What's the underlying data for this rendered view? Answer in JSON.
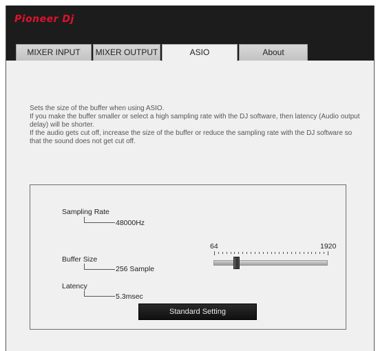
{
  "header": {
    "logo_text": "Pioneer Dj"
  },
  "tabs": [
    {
      "label": "MIXER INPUT",
      "active": false
    },
    {
      "label": "MIXER OUTPUT",
      "active": false
    },
    {
      "label": "ASIO",
      "active": true
    },
    {
      "label": "About",
      "active": false
    }
  ],
  "description": [
    "Sets the size of the buffer when using ASIO.",
    "If you make the buffer smaller or select a high sampling rate with the DJ software, then latency (Audio output delay) will be shorter.",
    "If the audio gets cut off, increase the size of the buffer or reduce the sampling rate with the DJ software so that the sound does not get cut off."
  ],
  "settings": {
    "sampling_rate_label": "Sampling Rate",
    "sampling_rate_value": "48000Hz",
    "buffer_size_label": "Buffer Size",
    "buffer_size_value": "256 Sample",
    "latency_label": "Latency",
    "latency_value": "5.3msec"
  },
  "slider": {
    "min_label": "64",
    "max_label": "1920",
    "min": 64,
    "max": 1920,
    "value": 256
  },
  "standard_button_label": "Standard Setting",
  "colors": {
    "logo": "#e0122b",
    "header_bg": "#1c1c1c",
    "panel_bg": "#f0f0f0",
    "button_bg": "#101010"
  }
}
